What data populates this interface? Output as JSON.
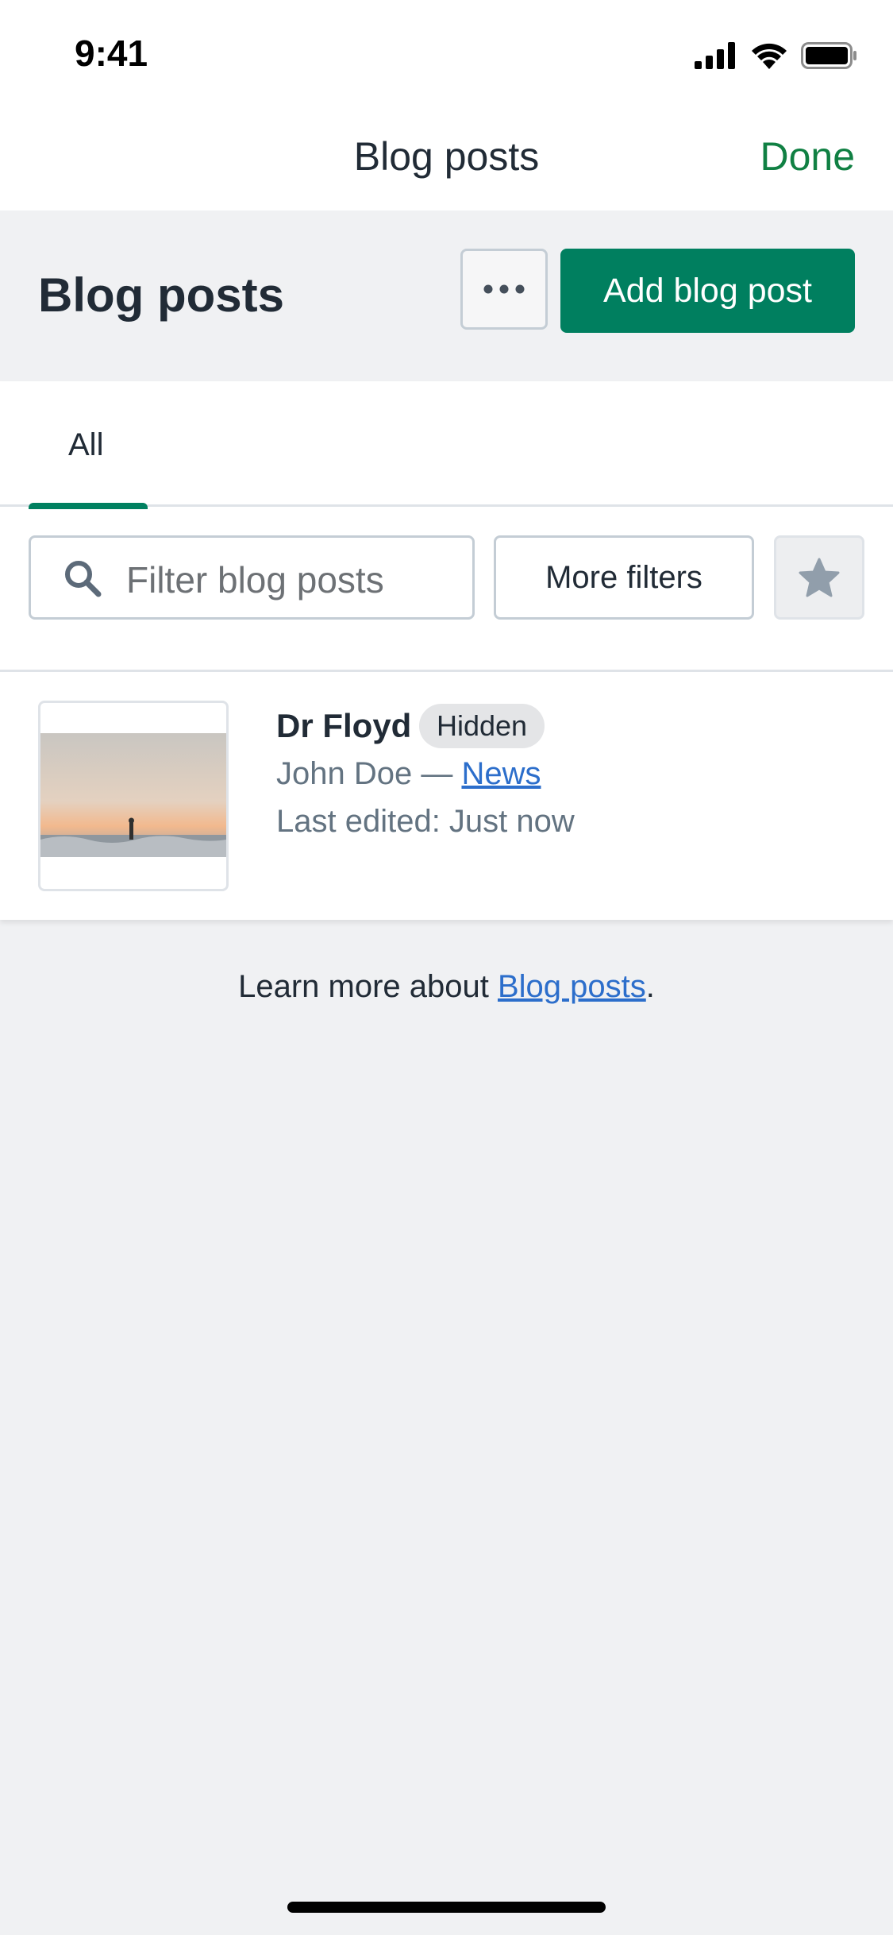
{
  "status_bar": {
    "time": "9:41"
  },
  "nav": {
    "title": "Blog posts",
    "done_label": "Done"
  },
  "page": {
    "title": "Blog posts",
    "add_button_label": "Add blog post"
  },
  "tabs": [
    {
      "label": "All",
      "selected": true
    }
  ],
  "filters": {
    "search_placeholder": "Filter blog posts",
    "more_filters_label": "More filters"
  },
  "posts": [
    {
      "title": "Dr Floyd",
      "badge": "Hidden",
      "author": "John Doe",
      "separator": " — ",
      "blog": "News",
      "last_edited": "Last edited: Just now"
    }
  ],
  "footer": {
    "learn_more_prefix": "Learn more about ",
    "learn_more_link": "Blog posts",
    "learn_more_suffix": "."
  },
  "colors": {
    "accent": "#008060",
    "link": "#2c6ecb",
    "done": "#108043",
    "background": "#f0f1f3"
  },
  "icons": [
    "signal-icon",
    "wifi-icon",
    "battery-icon",
    "ellipsis-icon",
    "search-icon",
    "star-icon"
  ]
}
